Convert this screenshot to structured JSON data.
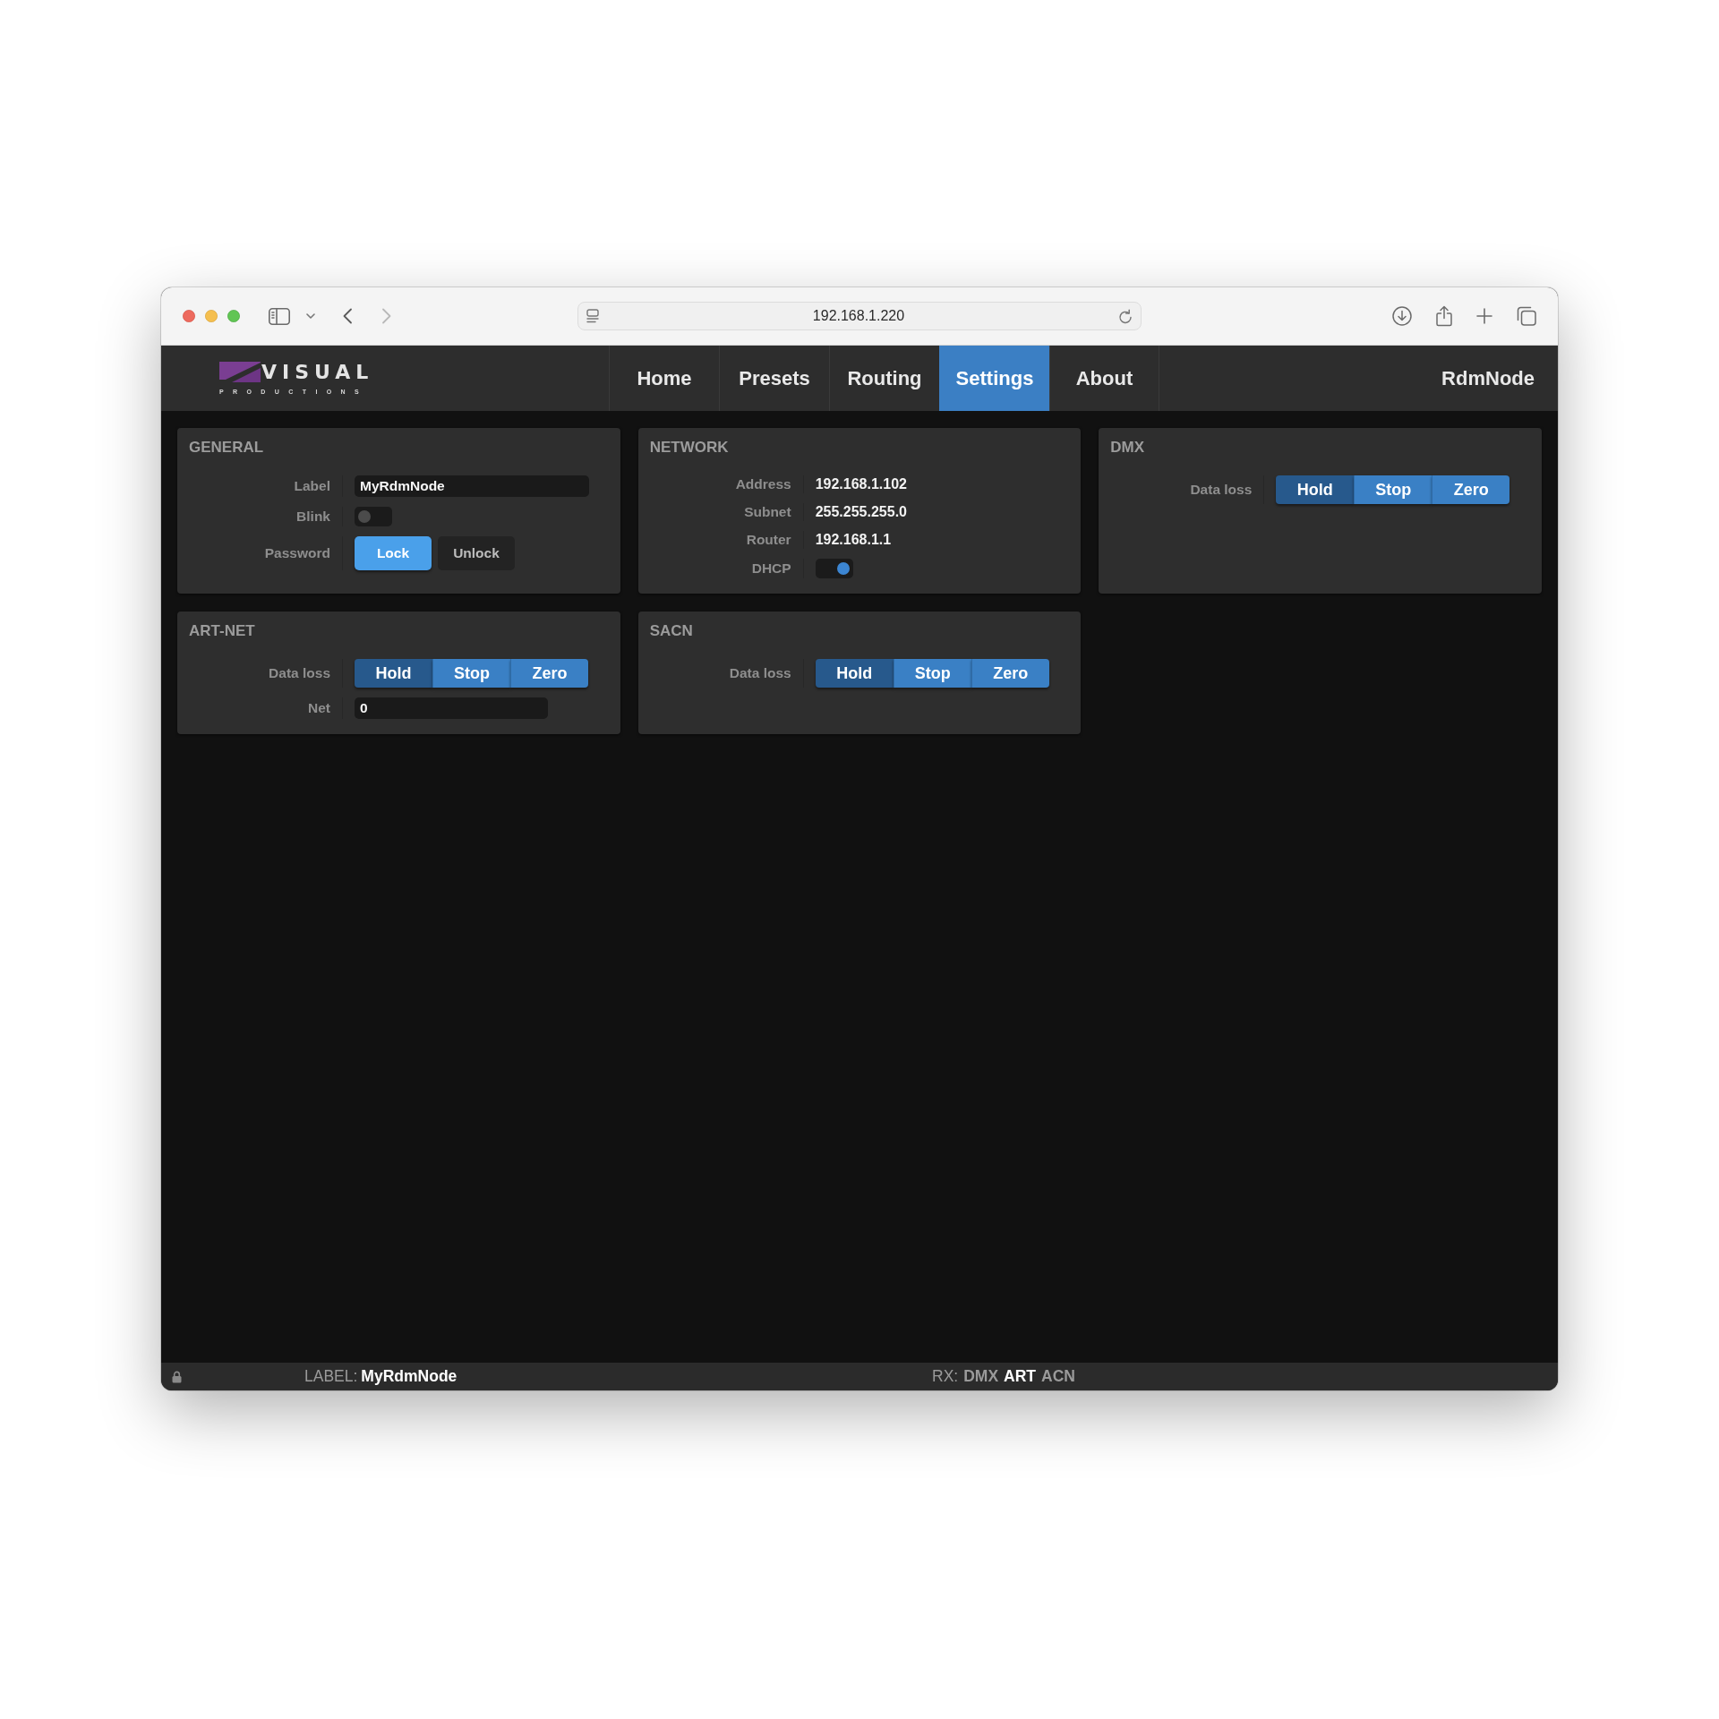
{
  "browser": {
    "nav_buttons": [
      {
        "kind": "back",
        "disabled": false
      },
      {
        "kind": "forward",
        "disabled": true
      }
    ],
    "url": "192.168.1.220"
  },
  "navbar": {
    "logo": {
      "wordmark": "VISUAL",
      "tagline": "PRODUCTIONS"
    },
    "tabs": [
      {
        "label": "Home",
        "selected": false
      },
      {
        "label": "Presets",
        "selected": false
      },
      {
        "label": "Routing",
        "selected": false
      },
      {
        "label": "Settings",
        "selected": true
      },
      {
        "label": "About",
        "selected": false
      }
    ],
    "device_name": "RdmNode"
  },
  "panels": [
    {
      "title": "GENERAL",
      "rows": [
        {
          "kind": "text_field",
          "label": "Label",
          "value": "MyRdmNode"
        },
        {
          "kind": "toggle",
          "label": "Blink",
          "on": false
        },
        {
          "kind": "buttons",
          "label": "Password",
          "options": [
            {
              "label": "Lock",
              "selected": true
            },
            {
              "label": "Unlock",
              "selected": false
            }
          ]
        }
      ]
    },
    {
      "title": "NETWORK",
      "rows": [
        {
          "kind": "value",
          "label": "Address",
          "value": "192.168.1.102"
        },
        {
          "kind": "value",
          "label": "Subnet",
          "value": "255.255.255.0"
        },
        {
          "kind": "value",
          "label": "Router",
          "value": "192.168.1.1"
        },
        {
          "kind": "toggle",
          "label": "DHCP",
          "on": true
        }
      ]
    },
    {
      "title": "DMX",
      "rows": [
        {
          "kind": "segmented",
          "label": "Data loss",
          "options": [
            {
              "label": "Hold",
              "selected": true
            },
            {
              "label": "Stop",
              "selected": false
            },
            {
              "label": "Zero",
              "selected": false
            }
          ]
        }
      ]
    },
    {
      "title": "ART-NET",
      "rows": [
        {
          "kind": "segmented",
          "label": "Data loss",
          "options": [
            {
              "label": "Hold",
              "selected": true
            },
            {
              "label": "Stop",
              "selected": false
            },
            {
              "label": "Zero",
              "selected": false
            }
          ]
        },
        {
          "kind": "number_field",
          "label": "Net",
          "value": "0"
        }
      ]
    },
    {
      "title": "SACN",
      "rows": [
        {
          "kind": "segmented",
          "label": "Data loss",
          "options": [
            {
              "label": "Hold",
              "selected": true
            },
            {
              "label": "Stop",
              "selected": false
            },
            {
              "label": "Zero",
              "selected": false
            }
          ]
        }
      ]
    }
  ],
  "status_bar": {
    "label_caption": "LABEL:",
    "label_value": "MyRdmNode",
    "rx_caption": "RX:",
    "rx": [
      {
        "label": "DMX",
        "active": false
      },
      {
        "label": "ART",
        "active": true
      },
      {
        "label": "ACN",
        "active": false
      }
    ]
  }
}
